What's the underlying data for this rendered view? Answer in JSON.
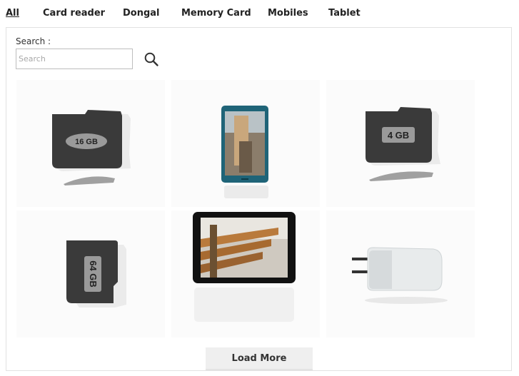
{
  "tabs": [
    {
      "label": "All",
      "active": true
    },
    {
      "label": "Card reader",
      "active": false
    },
    {
      "label": "Dongal",
      "active": false
    },
    {
      "label": "Memory Card",
      "active": false
    },
    {
      "label": "Mobiles",
      "active": false
    },
    {
      "label": "Tablet",
      "active": false
    }
  ],
  "search": {
    "label": "Search :",
    "placeholder": "Search",
    "value": "",
    "icon": "search-icon"
  },
  "products": [
    {
      "kind": "memory-card",
      "card_label": "16 GB"
    },
    {
      "kind": "phone",
      "card_label": ""
    },
    {
      "kind": "memory-card",
      "card_label": "4 GB"
    },
    {
      "kind": "memory-card-rotated",
      "card_label": "64 GB"
    },
    {
      "kind": "tablet",
      "card_label": ""
    },
    {
      "kind": "dongle",
      "card_label": ""
    }
  ],
  "load_more_label": "Load More",
  "colors": {
    "card_body": "#3a3a3a",
    "card_label_bg": "#9a9a9a",
    "phone_frame": "#1f6478",
    "tablet_frame": "#111111",
    "tile_bg": "#fbfbfb"
  }
}
